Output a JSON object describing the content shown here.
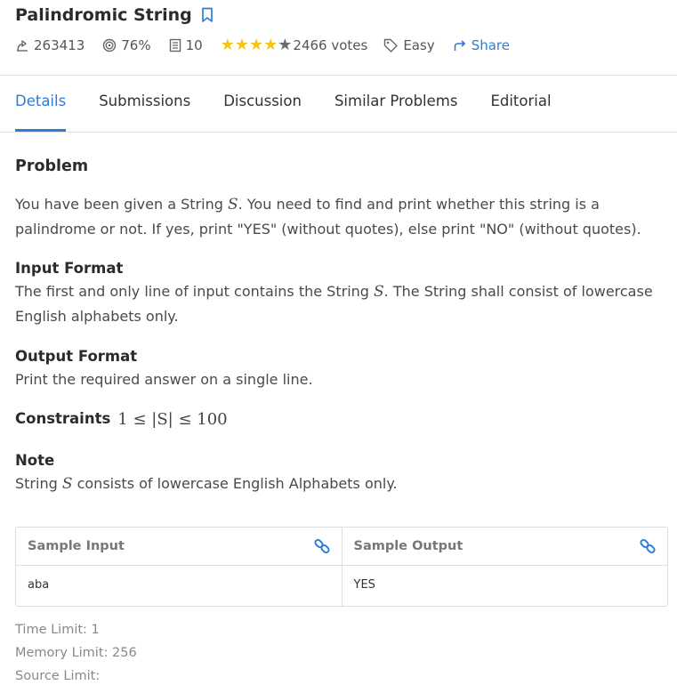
{
  "problem": {
    "title": "Palindromic String",
    "solved_count": "263413",
    "success_rate": "76%",
    "max_score": "10",
    "rating_stars": 4,
    "rating_total_stars": 5,
    "votes": "2466 votes",
    "difficulty": "Easy",
    "share_label": "Share"
  },
  "tabs": [
    {
      "label": "Details",
      "active": true
    },
    {
      "label": "Submissions",
      "active": false
    },
    {
      "label": "Discussion",
      "active": false
    },
    {
      "label": "Similar Problems",
      "active": false
    },
    {
      "label": "Editorial",
      "active": false
    }
  ],
  "body": {
    "problem_heading": "Problem",
    "statement_1": "You have been given a String ",
    "var_s": "S",
    "statement_2": ". You need to find and print whether this string is a palindrome or not. If yes, print \"YES\" (without quotes), else print \"NO\" (without quotes).",
    "input_heading": "Input Format",
    "input_1": "The first and only line of input contains the String ",
    "input_2": ". The String shall consist of lowercase English alphabets only.",
    "output_heading": "Output Format",
    "output_text": "Print the required answer on a single line.",
    "constraints_heading": "Constraints",
    "constraint_expr": "1 ≤ |S| ≤ 100",
    "note_heading": "Note",
    "note_1": "String ",
    "note_2": " consists of lowercase English Alphabets only."
  },
  "sample": {
    "input_label": "Sample Input",
    "output_label": "Sample Output",
    "input_value": "aba",
    "output_value": "YES"
  },
  "limits": {
    "time": "Time Limit: 1",
    "memory": "Memory Limit: 256",
    "source": "Source Limit:"
  },
  "colors": {
    "accent": "#2e7cd6",
    "star": "#f5c518"
  }
}
